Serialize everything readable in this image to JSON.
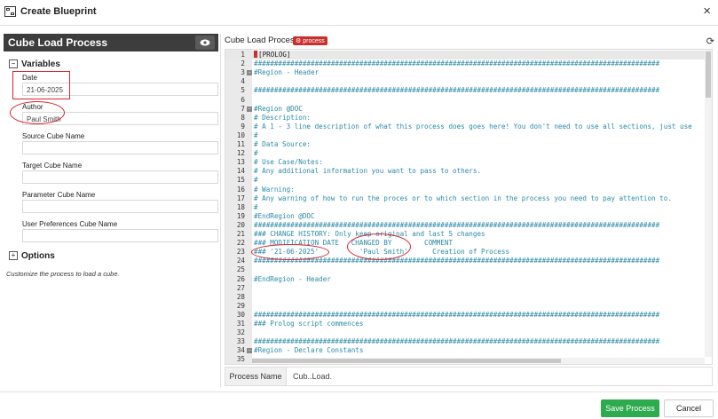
{
  "window": {
    "title": "Create Blueprint",
    "close_label": "×"
  },
  "left": {
    "header_title": "Cube Load Process",
    "variables_title": "Variables",
    "variables_toggle": "−",
    "fields": [
      {
        "label": "Date",
        "value": "21-06-2025"
      },
      {
        "label": "Author",
        "value": "Paul Smith"
      },
      {
        "label": "Source Cube Name",
        "value": ""
      },
      {
        "label": "Target Cube Name",
        "value": ""
      },
      {
        "label": "Parameter Cube Name",
        "value": ""
      },
      {
        "label": "User Preferences Cube Name",
        "value": ""
      }
    ],
    "options_title": "Options",
    "options_toggle": "+",
    "description": "Customize the process to load a cube."
  },
  "right": {
    "title": "Cube Load Process",
    "badge": "⚙ process",
    "refresh_glyph": "⟳",
    "process_name_label": "Process Name",
    "process_name_value": "Cub..Load."
  },
  "editor": {
    "lines": [
      {
        "n": "1",
        "text": "[PROLOG]",
        "plain": true,
        "hl": true,
        "cursor": true
      },
      {
        "n": "2",
        "text": "####################################################################################################"
      },
      {
        "n": "3",
        "text": "#Region - Header",
        "fold": "−"
      },
      {
        "n": "4",
        "text": ""
      },
      {
        "n": "5",
        "text": "####################################################################################################"
      },
      {
        "n": "6",
        "text": ""
      },
      {
        "n": "7",
        "text": "#Region @DOC",
        "fold": "−"
      },
      {
        "n": "8",
        "text": "# Description:"
      },
      {
        "n": "9",
        "text": "# A 1 - 3 line description of what this process does goes here! You don't need to use all sections, just use"
      },
      {
        "n": "10",
        "text": "#"
      },
      {
        "n": "11",
        "text": "# Data Source:"
      },
      {
        "n": "12",
        "text": "#"
      },
      {
        "n": "13",
        "text": "# Use Case/Notes:"
      },
      {
        "n": "14",
        "text": "# Any additional information you want to pass to others."
      },
      {
        "n": "15",
        "text": "#"
      },
      {
        "n": "16",
        "text": "# Warning:"
      },
      {
        "n": "17",
        "text": "# Any warning of how to run the proces or to which section in the process you need to pay attention to."
      },
      {
        "n": "18",
        "text": "#"
      },
      {
        "n": "19",
        "text": "#EndRegion @DOC"
      },
      {
        "n": "20",
        "text": "####################################################################################################"
      },
      {
        "n": "21",
        "text": "### CHANGE HISTORY: Only keep original and last 5 changes"
      },
      {
        "n": "22",
        "text": "### MODIFICATION DATE   CHANGED BY        COMMENT"
      },
      {
        "n": "23",
        "text": "### '21-06-2025'          'Paul Smith'      Creation of Process"
      },
      {
        "n": "24",
        "text": "####################################################################################################"
      },
      {
        "n": "25",
        "text": ""
      },
      {
        "n": "26",
        "text": "#EndRegion - Header"
      },
      {
        "n": "27",
        "text": ""
      },
      {
        "n": "28",
        "text": ""
      },
      {
        "n": "29",
        "text": ""
      },
      {
        "n": "30",
        "text": "####################################################################################################"
      },
      {
        "n": "31",
        "text": "### Prolog script commences"
      },
      {
        "n": "32",
        "text": ""
      },
      {
        "n": "33",
        "text": "####################################################################################################"
      },
      {
        "n": "34",
        "text": "#Region - Declare Constants",
        "fold": "−"
      },
      {
        "n": "35",
        "text": ""
      }
    ]
  },
  "footer": {
    "save_label": "Save Process",
    "cancel_label": "Cancel"
  },
  "colors": {
    "code_comment": "#2a8aa8",
    "accent_green": "#2eaa4f",
    "badge_red": "#c9302c",
    "annotation_red": "#d9232e",
    "header_dark": "#3d3d3d"
  }
}
